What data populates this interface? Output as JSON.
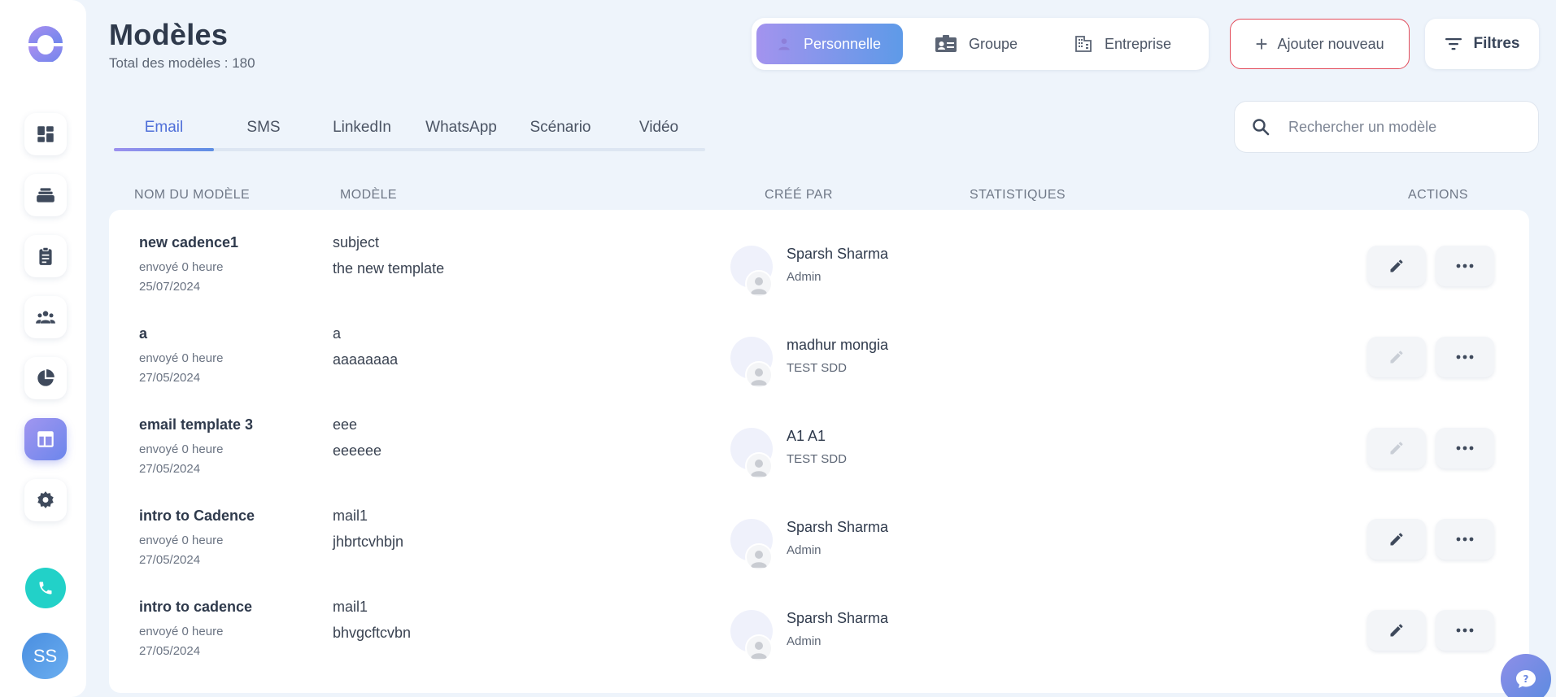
{
  "header": {
    "title": "Modèles",
    "subtitle": "Total des modèles : 180"
  },
  "scope_tabs": [
    {
      "label": "Personnelle",
      "icon": "user-icon",
      "active": true
    },
    {
      "label": "Groupe",
      "icon": "id-card-icon",
      "active": false
    },
    {
      "label": "Entreprise",
      "icon": "building-icon",
      "active": false
    }
  ],
  "actions": {
    "add_label": "Ajouter nouveau",
    "filter_label": "Filtres"
  },
  "tabs": [
    {
      "label": "Email",
      "active": true
    },
    {
      "label": "SMS",
      "active": false
    },
    {
      "label": "LinkedIn",
      "active": false
    },
    {
      "label": "WhatsApp",
      "active": false
    },
    {
      "label": "Scénario",
      "active": false
    },
    {
      "label": "Vidéo",
      "active": false
    }
  ],
  "search": {
    "placeholder": "Rechercher un modèle",
    "value": ""
  },
  "table": {
    "columns": [
      "NOM DU MODÈLE",
      "MODÈLE",
      "CRÉÉ PAR",
      "STATISTIQUES",
      "ACTIONS"
    ],
    "rows": [
      {
        "name": "new cadence1",
        "sent": "envoyé 0 heure",
        "date": "25/07/2024",
        "subject": "subject",
        "body": "the new template",
        "creator": "Sparsh Sharma",
        "role": "Admin",
        "editable": true
      },
      {
        "name": "a",
        "sent": "envoyé 0 heure",
        "date": "27/05/2024",
        "subject": "a",
        "body": "aaaaaaaa",
        "creator": "madhur mongia",
        "role": "TEST SDD",
        "editable": false
      },
      {
        "name": "email template 3",
        "sent": "envoyé 0 heure",
        "date": "27/05/2024",
        "subject": "eee",
        "body": "eeeeee",
        "creator": "A1 A1",
        "role": "TEST SDD",
        "editable": false
      },
      {
        "name": "intro to Cadence",
        "sent": "envoyé 0 heure",
        "date": "27/05/2024",
        "subject": "mail1",
        "body": "jhbrtcvhbjn",
        "creator": "Sparsh Sharma",
        "role": "Admin",
        "editable": true
      },
      {
        "name": "intro to cadence",
        "sent": "envoyé 0 heure",
        "date": "27/05/2024",
        "subject": "mail1",
        "body": "bhvgcftcvbn",
        "creator": "Sparsh Sharma",
        "role": "Admin",
        "editable": true
      }
    ]
  },
  "sidebar": {
    "items": [
      {
        "icon": "dashboard-icon",
        "active": false
      },
      {
        "icon": "cadence-icon",
        "active": false
      },
      {
        "icon": "tasks-icon",
        "active": false
      },
      {
        "icon": "people-icon",
        "active": false
      },
      {
        "icon": "reports-icon",
        "active": false
      },
      {
        "icon": "templates-icon",
        "active": true
      },
      {
        "icon": "settings-icon",
        "active": false
      }
    ],
    "user_initials": "SS"
  },
  "colors": {
    "accent": "#6c86ec",
    "danger_border": "#e24b5a",
    "phone": "#22d1c8"
  }
}
